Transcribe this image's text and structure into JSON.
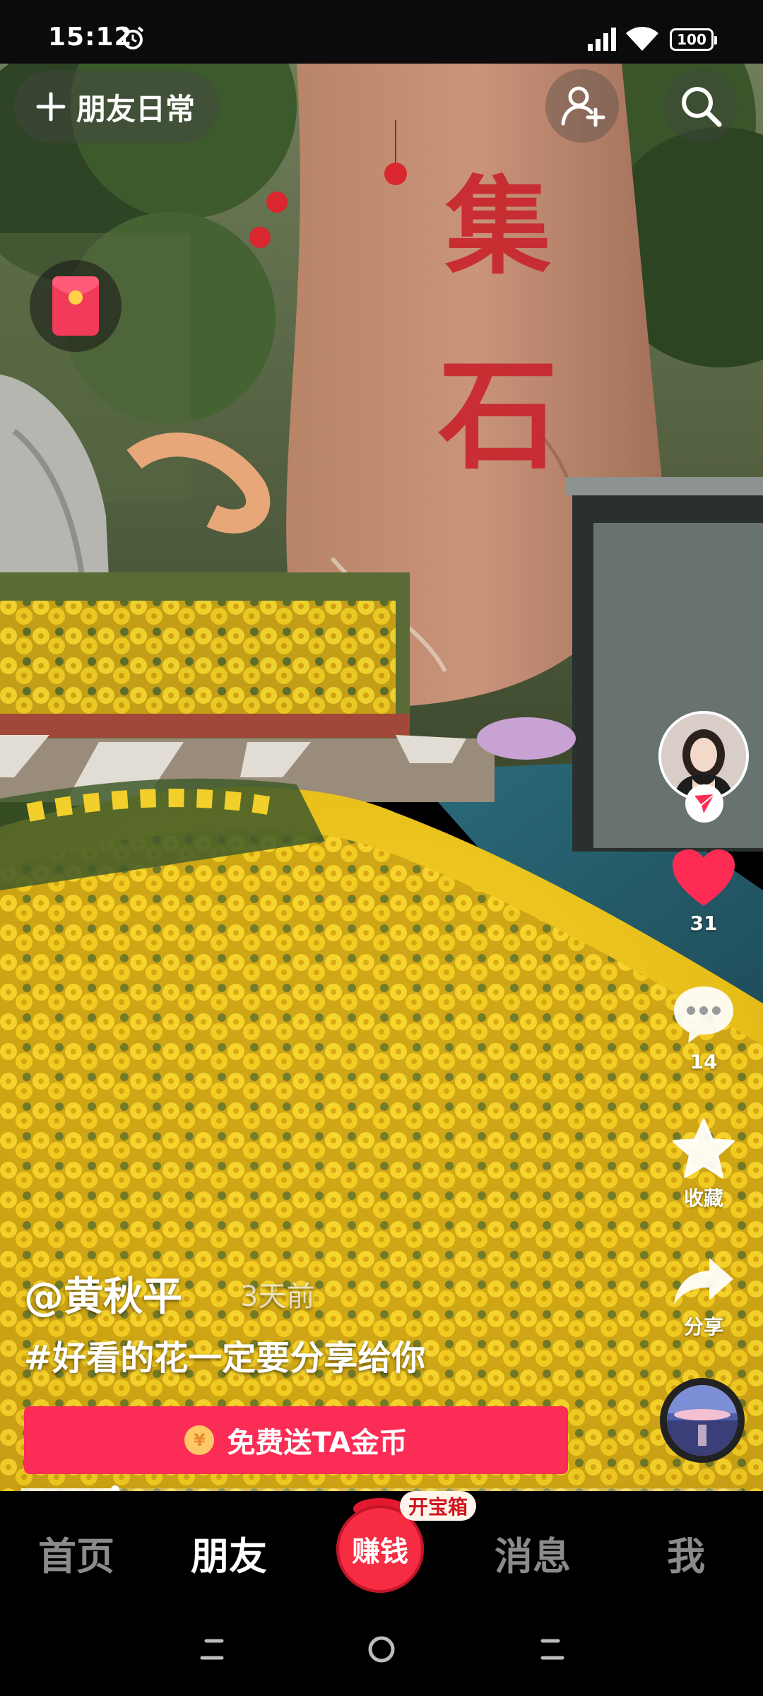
{
  "status_bar": {
    "time": "15:12",
    "battery": "100",
    "icons": [
      "alarm-icon",
      "signal-icon",
      "wifi-icon",
      "battery-icon"
    ]
  },
  "top_bar": {
    "friends_daily_label": "朋友日常",
    "add_friend_icon": "add-friend-icon",
    "search_icon": "search-icon"
  },
  "video": {
    "stone_chars": [
      "集",
      "石"
    ]
  },
  "side_actions": {
    "like_count": "31",
    "comment_count": "14",
    "favorite_label": "收藏",
    "share_label": "分享",
    "like_color": "#fe2c55"
  },
  "caption": {
    "author": "@黄秋平",
    "time_ago": "3天前",
    "hashtag": "#好看的花一定要分享给你"
  },
  "coin_banner": {
    "label": "免费送TA金币",
    "coin_symbol": "¥",
    "color": "#fb2c55"
  },
  "progress": {
    "played_fraction": 0.13
  },
  "bottom_nav": {
    "home": "首页",
    "friends": "朋友",
    "earn": "赚钱",
    "treasure_badge": "开宝箱",
    "messages": "消息",
    "me": "我",
    "active": "朋友"
  }
}
